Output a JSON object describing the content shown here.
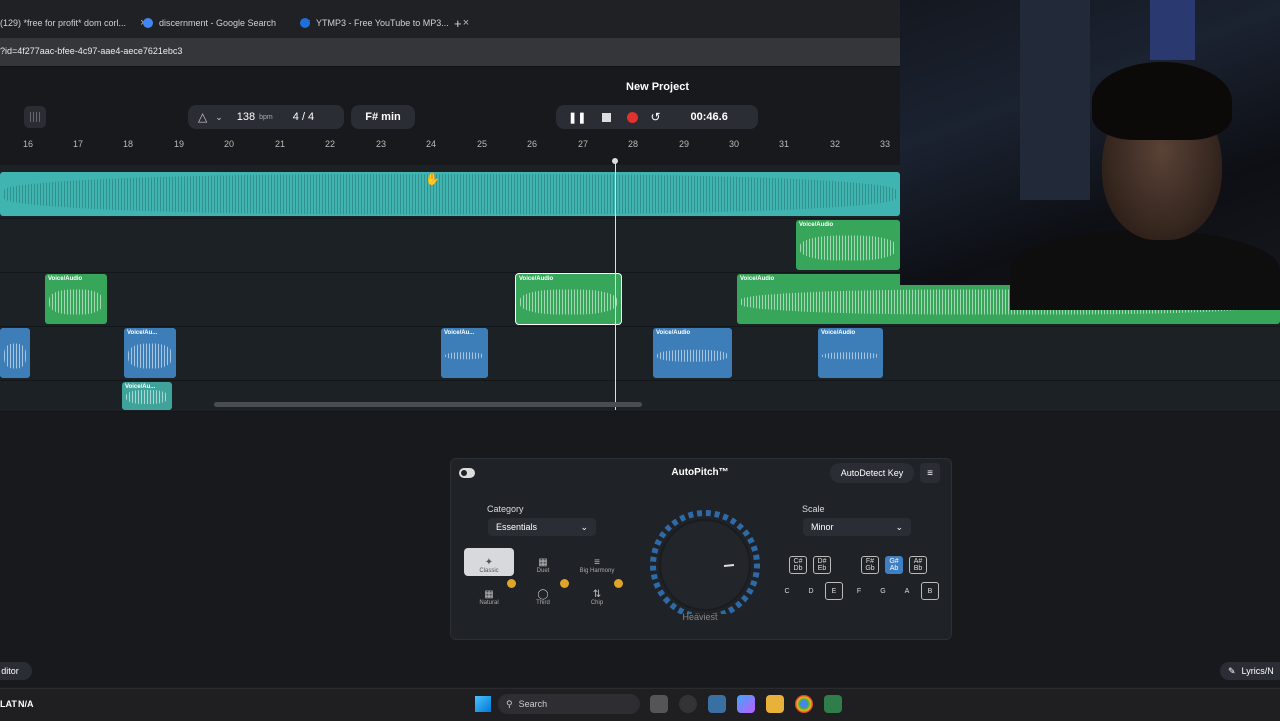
{
  "browser": {
    "tabs": [
      {
        "title": "(129) *free for profit* dom corl...",
        "favicon_color": "#ff0000"
      },
      {
        "title": "discernment - Google Search",
        "favicon_color": "#4285f4"
      },
      {
        "title": "YTMP3 - Free YouTube to MP3...",
        "favicon_color": "#1e6fd9"
      }
    ],
    "new_tab": "+",
    "close_glyph": "×",
    "url": "?id=4f277aac-bfee-4c97-aae4-aece7621ebc3"
  },
  "app": {
    "project_title": "New Project",
    "tempo": {
      "bpm_value": "138",
      "bpm_unit": "bpm",
      "time_signature": "4 / 4"
    },
    "key": "F# min",
    "transport": {
      "time": "00:46.6"
    },
    "ruler_labels": [
      "16",
      "17",
      "18",
      "19",
      "20",
      "21",
      "22",
      "23",
      "24",
      "25",
      "26",
      "27",
      "28",
      "29",
      "30",
      "31",
      "32",
      "33"
    ],
    "clips": {
      "voice_audio": "Voice/Audio",
      "voice_au_short": "Voice/Au..."
    },
    "left_footer": "ditor",
    "right_footer": "Lyrics/N"
  },
  "autopitch": {
    "title": "AutoPitch™",
    "autodetect_label": "AutoDetect Key",
    "category_label": "Category",
    "category_value": "Essentials",
    "scale_label": "Scale",
    "scale_value": "Minor",
    "modes": [
      {
        "label": "Classic",
        "selected": true
      },
      {
        "label": "Duet"
      },
      {
        "label": "Big Harmony"
      },
      {
        "label": "Natural"
      },
      {
        "label": "Third"
      },
      {
        "label": "Chip"
      }
    ],
    "knob_label": "Heaviest",
    "sharp_keys": [
      {
        "top": "C#",
        "bottom": "Db"
      },
      {
        "top": "D#",
        "bottom": "Eb"
      },
      {
        "top": "F#",
        "bottom": "Gb"
      },
      {
        "top": "G#",
        "bottom": "Ab",
        "selected": true
      },
      {
        "top": "A#",
        "bottom": "Bb"
      }
    ],
    "natural_keys": [
      {
        "label": "C"
      },
      {
        "label": "D"
      },
      {
        "label": "E",
        "boxed": true
      },
      {
        "label": "F"
      },
      {
        "label": "G"
      },
      {
        "label": "A"
      },
      {
        "label": "B",
        "boxed": true
      }
    ]
  },
  "taskbar": {
    "language": "LAT",
    "na": "N/A",
    "search_placeholder": "Search"
  },
  "colors": {
    "track_teal": "#3fb4b0",
    "track_green": "#37a55a",
    "track_blue": "#3d7db8",
    "record_red": "#e0322f",
    "accent_blue": "#3f7fc4"
  }
}
